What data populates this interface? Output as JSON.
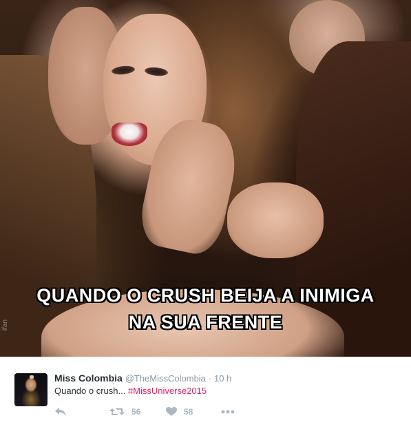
{
  "meme": {
    "caption_line1": "QUANDO O CRUSH BEIJA A INIMIGA",
    "caption_line2": "NA SUA FRENTE",
    "watermark": "ifan"
  },
  "tweet": {
    "name": "Miss Colombia",
    "handle": "@TheMissColombia",
    "separator": "·",
    "time": "10 h",
    "text": "Quando o crush... ",
    "hashtag": "#MissUniverse2015",
    "retweets": "56",
    "likes": "58"
  },
  "icons": {
    "reply": "reply-icon",
    "retweet": "retweet-icon",
    "like": "heart-icon",
    "more": "more-dots-icon"
  },
  "colors": {
    "hashtag": "#e0245e",
    "muted": "#8899a6",
    "action": "#aab8c2",
    "name": "#292f33"
  }
}
